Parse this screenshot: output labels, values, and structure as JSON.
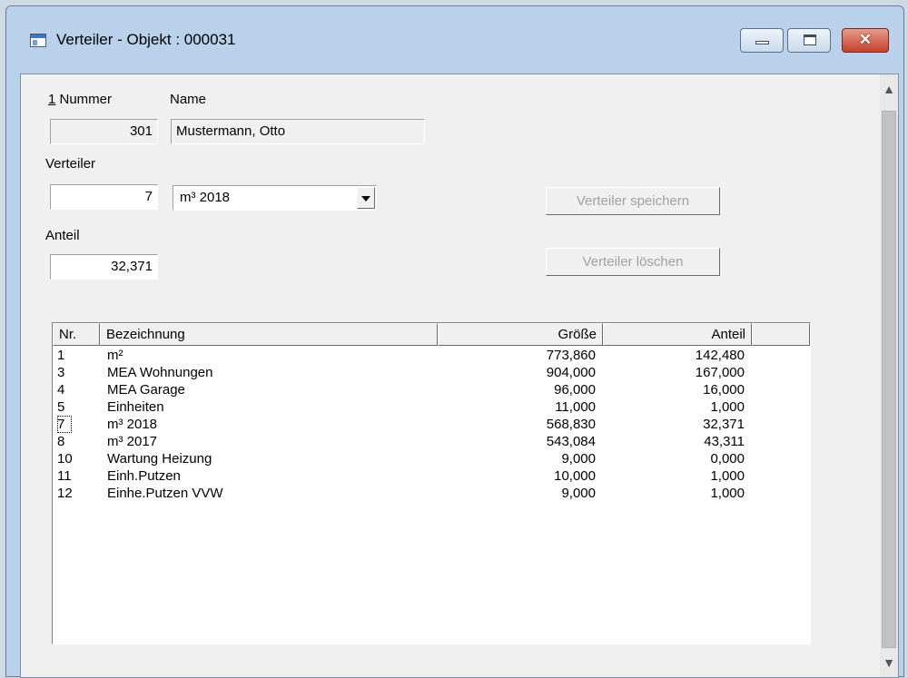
{
  "window": {
    "title": "Verteiler - Objekt : 000031",
    "close_glyph": "✕"
  },
  "form": {
    "nummer_label_key": "1",
    "nummer_label_rest": " Nummer",
    "name_label": "Name",
    "nummer_value": "301",
    "name_value": "Mustermann, Otto",
    "verteiler_label": "Verteiler",
    "verteiler_number": "7",
    "verteiler_selected": "m³ 2018",
    "anteil_label": "Anteil",
    "anteil_value": "32,371",
    "save_button": "Verteiler speichern",
    "delete_button": "Verteiler löschen"
  },
  "list": {
    "columns": [
      "Nr.",
      "Bezeichnung",
      "Größe",
      "Anteil"
    ],
    "rows": [
      {
        "nr": "1",
        "bez": "m²",
        "groesse": "773,860",
        "anteil": "142,480"
      },
      {
        "nr": "3",
        "bez": "MEA Wohnungen",
        "groesse": "904,000",
        "anteil": "167,000"
      },
      {
        "nr": "4",
        "bez": "MEA Garage",
        "groesse": "96,000",
        "anteil": "16,000"
      },
      {
        "nr": "5",
        "bez": "Einheiten",
        "groesse": "11,000",
        "anteil": "1,000"
      },
      {
        "nr": "7",
        "bez": "m³ 2018",
        "groesse": "568,830",
        "anteil": "32,371"
      },
      {
        "nr": "8",
        "bez": "m³ 2017",
        "groesse": "543,084",
        "anteil": "43,311"
      },
      {
        "nr": "10",
        "bez": "Wartung Heizung",
        "groesse": "9,000",
        "anteil": "0,000"
      },
      {
        "nr": "11",
        "bez": "Einh.Putzen",
        "groesse": "10,000",
        "anteil": "1,000"
      },
      {
        "nr": "12",
        "bez": "Einhe.Putzen VVW",
        "groesse": "9,000",
        "anteil": "1,000"
      }
    ]
  },
  "scrollbar": {
    "up_icon": "chevron-up-icon",
    "down_icon": "chevron-down-icon"
  }
}
